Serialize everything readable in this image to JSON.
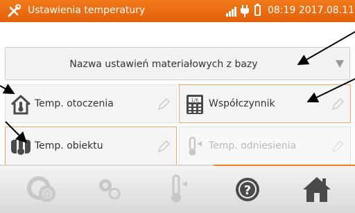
{
  "status_bar": {
    "title": "Ustawienia temperatury",
    "time": "08:19",
    "date": "2017.08.11",
    "icons": [
      "tools-icon",
      "signal-icon",
      "plug-icon",
      "battery-icon"
    ]
  },
  "dropdown": {
    "label": "Nazwa ustawień materiałowych z bazy",
    "icon": "triangle-down-icon"
  },
  "tiles": [
    {
      "label": "Temp. otoczenia",
      "icon": "house-thermometer-icon",
      "state": "enabled"
    },
    {
      "label": "Współczynnik",
      "icon": "calculator-1k-icon",
      "state": "selected"
    },
    {
      "label": "Temp. obiektu",
      "icon": "object-thermometer-icon",
      "state": "selected"
    },
    {
      "label": "Temp. odniesienia",
      "icon": "thermometer-reference-icon",
      "state": "disabled"
    }
  ],
  "toolbar": {
    "buttons": [
      "reset-icon",
      "settings-icon",
      "thermometer-icon",
      "help-icon",
      "home-icon"
    ]
  },
  "colors": {
    "accent": "#ee7d25",
    "status_bar": "#e96b12",
    "tile_bg": "#f5f5f5",
    "icon_dark": "#4a4a4a",
    "icon_disabled": "#c8c8c8"
  }
}
